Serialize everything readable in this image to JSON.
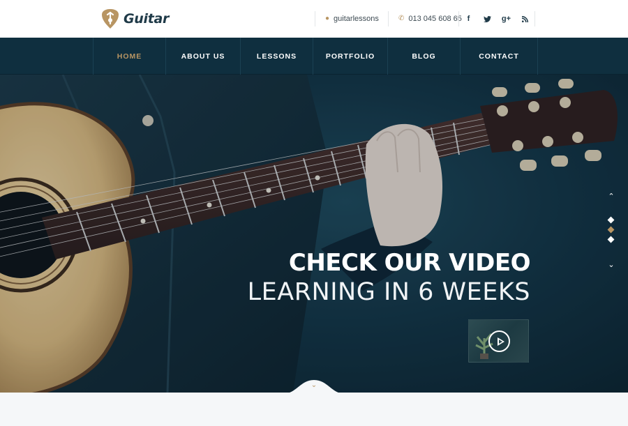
{
  "brand": {
    "name": "Guitar",
    "accent": "#b89563",
    "nav_bg": "#0f2f3f"
  },
  "topbar": {
    "skype": {
      "icon": "skype-icon",
      "label": "guitarlessons"
    },
    "phone": {
      "icon": "phone-icon",
      "label": "013 045 608 65"
    },
    "social": [
      {
        "name": "facebook-icon",
        "glyph": "f"
      },
      {
        "name": "twitter-icon",
        "glyph": "t"
      },
      {
        "name": "google-plus-icon",
        "glyph": "g+"
      },
      {
        "name": "rss-icon",
        "glyph": "rss"
      }
    ]
  },
  "nav": {
    "items": [
      {
        "label": "HOME",
        "active": true
      },
      {
        "label": "ABOUT US",
        "active": false
      },
      {
        "label": "LESSONS",
        "active": false
      },
      {
        "label": "PORTFOLIO",
        "active": false
      },
      {
        "label": "BLOG",
        "active": false
      },
      {
        "label": "CONTACT",
        "active": false
      }
    ]
  },
  "hero": {
    "title_line1": "CHECK OUR VIDEO",
    "title_line2": "LEARNING IN 6 WEEKS",
    "slides": {
      "count": 3,
      "active_index": 1
    }
  }
}
